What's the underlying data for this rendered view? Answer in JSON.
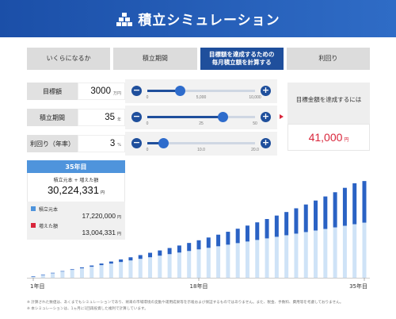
{
  "header": {
    "title": "積立シミュレーション",
    "logo_icon": "coin-stack-icon"
  },
  "tabs": [
    {
      "label": "いくらになるか",
      "active": false
    },
    {
      "label": "積立期間",
      "active": false
    },
    {
      "label_line1": "目標額を達成するための",
      "label_line2": "毎月積立額を計算する",
      "active": true
    },
    {
      "label": "利回り",
      "active": false
    }
  ],
  "params": [
    {
      "label": "目標額",
      "value": "3000",
      "unit": "万円",
      "min": 0,
      "max": 10000,
      "current": 3000,
      "ticks": [
        "0",
        "5,000",
        "10,000"
      ]
    },
    {
      "label": "積立期間",
      "value": "35",
      "unit": "年",
      "min": 0,
      "max": 50,
      "current": 35,
      "ticks": [
        "0",
        "25",
        "50"
      ]
    },
    {
      "label": "利回り（年率）",
      "value": "3",
      "unit": "%",
      "min": 0,
      "max": 20,
      "current": 3,
      "ticks": [
        "0",
        "10.0",
        "20.0"
      ]
    }
  ],
  "result": {
    "caption": "目標金額を達成するには",
    "amount": "41,000",
    "unit": "円"
  },
  "info": {
    "year": "35年目",
    "total_label": "積立元本 + 増えた額",
    "total_value": "30,224,331",
    "total_unit": "円",
    "principal_label": "積立元本",
    "principal_value": "17,220,000",
    "gain_label": "増えた額",
    "gain_value": "13,004,331",
    "unit": "円"
  },
  "colors": {
    "principal": "#cfe3f7",
    "gain": "#2a62c4",
    "accent": "#1f4f9c",
    "red": "#d9263b"
  },
  "chart_data": {
    "type": "bar",
    "stacked": true,
    "categories": [
      "1年目",
      "2",
      "3",
      "4",
      "5",
      "6",
      "7",
      "8",
      "9",
      "10",
      "11",
      "12",
      "13",
      "14",
      "15",
      "16",
      "17",
      "18年目",
      "19",
      "20",
      "21",
      "22",
      "23",
      "24",
      "25",
      "26",
      "27",
      "28",
      "29",
      "30",
      "31",
      "32",
      "33",
      "34",
      "35年目"
    ],
    "x_tick_labels": [
      "1年目",
      "18年目",
      "35年目"
    ],
    "series": [
      {
        "name": "積立元本",
        "values": [
          0.49,
          0.98,
          1.48,
          1.97,
          2.46,
          2.95,
          3.44,
          3.94,
          4.43,
          4.92,
          5.41,
          5.9,
          6.4,
          6.89,
          7.38,
          7.87,
          8.36,
          8.86,
          9.35,
          9.84,
          10.33,
          10.82,
          11.32,
          11.81,
          12.3,
          12.79,
          13.28,
          13.78,
          14.27,
          14.76,
          15.25,
          15.74,
          16.24,
          16.73,
          17.22
        ]
      },
      {
        "name": "増えた額",
        "values": [
          0.01,
          0.03,
          0.07,
          0.12,
          0.19,
          0.28,
          0.38,
          0.5,
          0.64,
          0.8,
          0.98,
          1.18,
          1.4,
          1.64,
          1.91,
          2.2,
          2.51,
          2.85,
          3.22,
          3.62,
          4.04,
          4.5,
          4.98,
          5.5,
          6.05,
          6.64,
          7.26,
          7.92,
          8.62,
          9.37,
          10.15,
          10.98,
          11.86,
          12.79,
          13.0
        ]
      }
    ],
    "unit": "百万円",
    "ylim": [
      0,
      31
    ]
  },
  "notes": [
    "※ 計算された数値は、あくまでもシミュレーションであり、将来の市場環境の変動や運用成果等を示唆および保証するものではありません。また、税金、手数料、費用等を考慮しておりません。",
    "※ 本シミュレーションは、1ヵ月に1回再投資した複利で計算しています。"
  ]
}
